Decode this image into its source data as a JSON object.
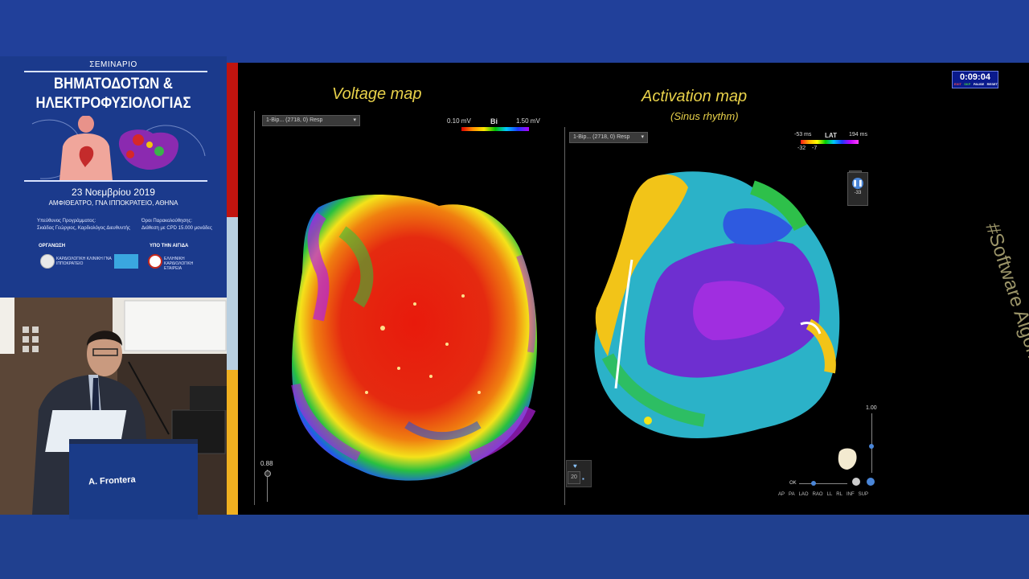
{
  "poster": {
    "seminar": "ΣΕΜΙΝΑΡΙΟ",
    "title_line1": "ΒΗΜΑΤΟΔΟΤΩΝ &",
    "title_line2": "ΗΛΕΚΤΡΟΦΥΣΙΟΛΟΓΙΑΣ",
    "date": "23 Νοεμβρίου 2019",
    "venue": "ΑΜΦΙΘΕΑΤΡΟ, ΓΝΑ ΙΠΠΟΚΡΑΤΕΙΟ, ΑΘΗΝΑ",
    "responsible_label": "Υπεύθυνος Προγράμματος:",
    "responsible_name": "Σκιάδας Γεώργιος, Καρδιολόγος Διευθυντής",
    "credits_label": "Όροι Παρακολούθησης:",
    "credits_text": "Διάθεση με CPD 15.000 μονάδες",
    "organizer_label": "ΟΡΓΑΝΩΣΗ",
    "auspices_label": "ΥΠΟ ΤΗΝ ΑΙΓΙΔΑ",
    "org1": "ΚΑΡΔΙΟΛΟΓΙΚΗ ΚΛΙΝΙΚΗ ΓΝΑ ΙΠΠΟΚΡΑΤΕΙΟ",
    "org2": "ΕΛΛΗΝΙΚΗ ΚΑΡΔΙΟΛΟΓΙΚΗ ΕΤΑΙΡΕΙΑ"
  },
  "speaker": {
    "name": "A. Frontera"
  },
  "screen": {
    "voltage_title": "Voltage map",
    "activation_title": "Activation map",
    "activation_subtitle": "(Sinus rhythm)",
    "voltage_dropdown": "1-Bip... (2718, 0) Resp",
    "activation_dropdown": "1-Bip... (2718, 0) Resp",
    "voltage_scale": {
      "min": "0.10 mV",
      "label": "Bi",
      "max": "1.50 mV"
    },
    "lat_scale": {
      "min": "-53 ms",
      "label": "LAT",
      "max": "194 ms",
      "sub1": "-32",
      "sub2": "-7"
    },
    "left_slider_value": "0.88",
    "right_slider_value": "1.00",
    "pause_badge": "-33",
    "box_value": "20",
    "ok_label": "OK",
    "view_buttons": [
      "AP",
      "PA",
      "LAO",
      "RAO",
      "LL",
      "RL",
      "INF",
      "SUP"
    ],
    "hashtag": "#Software Algoritms"
  },
  "timer": {
    "value": "0:09:04",
    "buttons": [
      "EXIT",
      "SKP",
      "PAUSE",
      "RESET"
    ],
    "button_colors": [
      "#ff4a4a",
      "#40d040",
      "#ffffff",
      "#ffffff"
    ]
  },
  "colors": {
    "title_color": "#e8d14a",
    "background_blue": "#21409a",
    "side_bar": [
      "#c0140f",
      "#b9cfe0",
      "#f0b020"
    ]
  }
}
